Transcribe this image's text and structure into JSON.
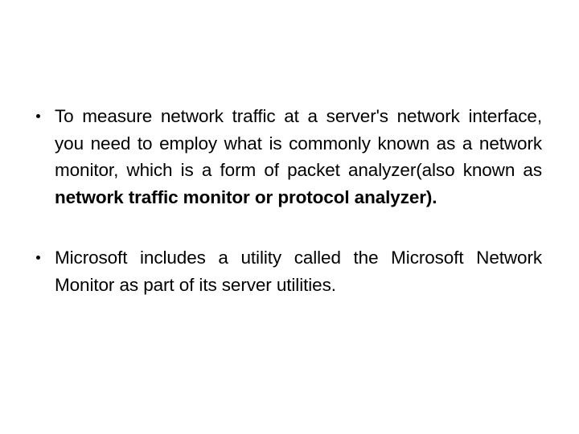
{
  "slide": {
    "background_color": "#ffffff",
    "text_color": "#000000",
    "bullet_glyph": "•",
    "body": {
      "bullets": [
        {
          "id": "bullet-network-monitor",
          "plain_prefix": "To measure network traffic at a server's network interface, you need to employ what is commonly known as a network monitor, which is a form of packet analyzer(also known as ",
          "bold_run": "network traffic monitor or protocol analyzer).",
          "full_text": "To measure network traffic at a server's network interface, you need to employ what is commonly known as a network monitor, which is a form of packet analyzer(also known as network traffic monitor or protocol analyzer)."
        },
        {
          "id": "bullet-microsoft-netmon",
          "plain_prefix": "Microsoft includes a utility called the Microsoft Network Monitor as part of its server utilities.",
          "bold_run": "",
          "full_text": "Microsoft includes a utility called the Microsoft Network Monitor as part of its server utilities."
        }
      ]
    }
  }
}
